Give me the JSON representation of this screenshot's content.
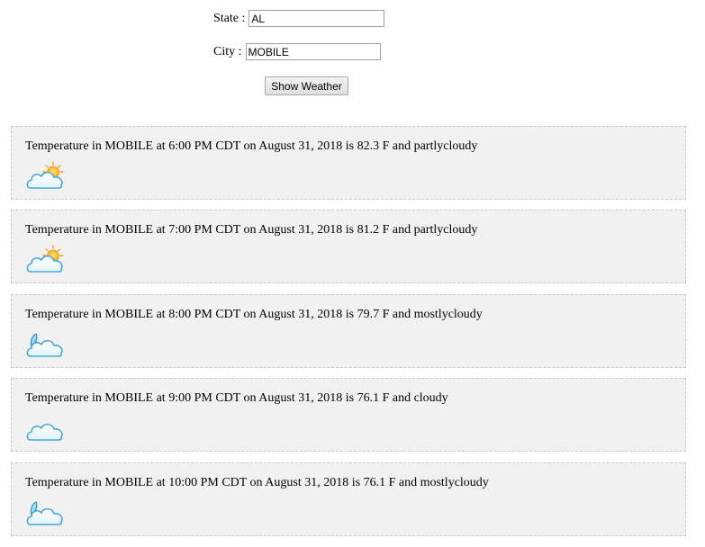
{
  "form": {
    "state_label": "State :",
    "state_value": "AL",
    "city_label": "City :",
    "city_value": "MOBILE",
    "button_label": "Show Weather"
  },
  "forecasts": [
    {
      "text": "Temperature in MOBILE at 6:00 PM CDT on August 31, 2018 is 82.3 F and partlycloudy",
      "icon": "partly-cloudy-day-icon"
    },
    {
      "text": "Temperature in MOBILE at 7:00 PM CDT on August 31, 2018 is 81.2 F and partlycloudy",
      "icon": "partly-cloudy-day-icon"
    },
    {
      "text": "Temperature in MOBILE at 8:00 PM CDT on August 31, 2018 is 79.7 F and mostlycloudy",
      "icon": "mostly-cloudy-night-icon"
    },
    {
      "text": "Temperature in MOBILE at 9:00 PM CDT on August 31, 2018 is 76.1 F and cloudy",
      "icon": "cloudy-icon"
    },
    {
      "text": "Temperature in MOBILE at 10:00 PM CDT on August 31, 2018 is 76.1 F and mostlycloudy",
      "icon": "mostly-cloudy-night-icon"
    }
  ]
}
